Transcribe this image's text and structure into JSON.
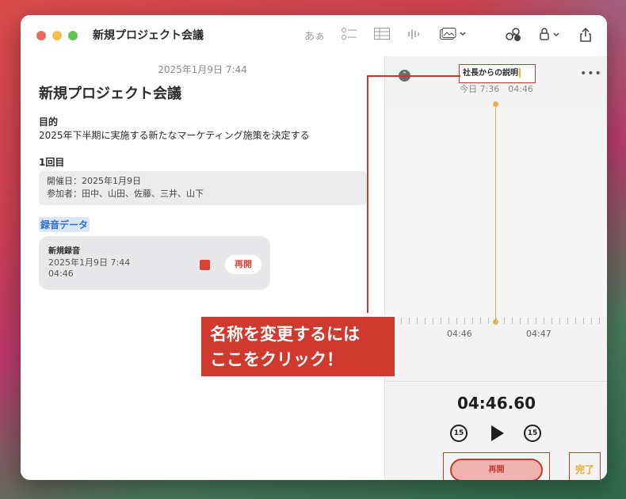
{
  "window": {
    "title": "新規プロジェクト会議"
  },
  "toolbar": {
    "aa_label": "あぁ"
  },
  "note": {
    "date": "2025年1月9日 7:44",
    "title": "新規プロジェクト会議",
    "purpose_heading": "目的",
    "purpose_text": "2025年下半期に実施する新たなマーケティング施策を決定する",
    "first_heading": "1回目",
    "info_line1": "開催日：2025年1月9日",
    "info_line2": "参加者：田中、山田、佐藤、三井、山下",
    "recording_heading": "録音データ",
    "recording": {
      "name": "新規録音",
      "date": "2025年1月9日 7:44",
      "duration": "04:46",
      "resume_label": "再開"
    }
  },
  "panel": {
    "title": "社長からの説明",
    "subtitle": "今日 7:36　04:46",
    "tick1": "04:46",
    "tick2": "04:47",
    "time": "04:46.60",
    "skip_back": "15",
    "skip_fwd": "15",
    "resume_label": "再開",
    "done_label": "完了"
  },
  "callout": {
    "line1": "名称を変更するには",
    "line2": "ここをクリック！"
  },
  "colors": {
    "accent_red": "#d0392e",
    "link_blue": "#2f6fd1",
    "playhead": "#e6b04a"
  }
}
